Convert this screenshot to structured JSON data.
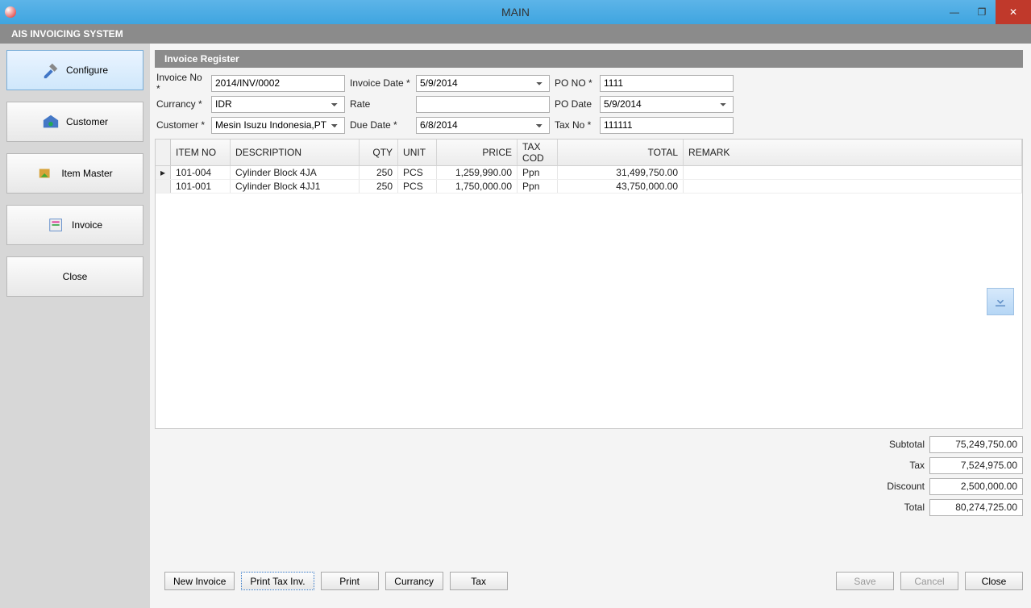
{
  "window": {
    "title": "MAIN"
  },
  "app_title": "AIS INVOICING SYSTEM",
  "sidebar": {
    "items": [
      {
        "label": "Configure",
        "icon": "configure",
        "active": true
      },
      {
        "label": "Customer",
        "icon": "customer",
        "active": false
      },
      {
        "label": "Item Master",
        "icon": "item-master",
        "active": false
      },
      {
        "label": "Invoice",
        "icon": "invoice",
        "active": false
      },
      {
        "label": "Close",
        "icon": "",
        "active": false
      }
    ]
  },
  "panel": {
    "title": "Invoice Register"
  },
  "form": {
    "labels": {
      "invoice_no": "Invoice No *",
      "invoice_date": "Invoice Date *",
      "po_no": "PO NO *",
      "currency": "Currancy *",
      "rate": "Rate",
      "po_date": "PO Date",
      "customer": "Customer *",
      "due_date": "Due Date *",
      "tax_no": "Tax No *"
    },
    "values": {
      "invoice_no": "2014/INV/0002",
      "invoice_date": "5/9/2014",
      "po_no": "1111",
      "currency": "IDR",
      "rate": "",
      "po_date": "5/9/2014",
      "customer": "Mesin Isuzu Indonesia,PT",
      "due_date": "6/8/2014",
      "tax_no": "111111"
    }
  },
  "grid": {
    "headers": {
      "item_no": "ITEM NO",
      "description": "DESCRIPTION",
      "qty": "QTY",
      "unit": "UNIT",
      "price": "PRICE",
      "tax_code": "TAX COD",
      "total": "TOTAL",
      "remark": "REMARK"
    },
    "rows": [
      {
        "item_no": "101-004",
        "description": "Cylinder Block 4JA",
        "qty": "250",
        "unit": "PCS",
        "price": "1,259,990.00",
        "tax_code": "Ppn",
        "total": "31,499,750.00",
        "remark": "",
        "current": true
      },
      {
        "item_no": "101-001",
        "description": "Cylinder Block 4JJ1",
        "qty": "250",
        "unit": "PCS",
        "price": "1,750,000.00",
        "tax_code": "Ppn",
        "total": "43,750,000.00",
        "remark": "",
        "current": false
      }
    ]
  },
  "totals": {
    "labels": {
      "subtotal": "Subtotal",
      "tax": "Tax",
      "discount": "Discount",
      "total": "Total"
    },
    "values": {
      "subtotal": "75,249,750.00",
      "tax": "7,524,975.00",
      "discount": "2,500,000.00",
      "total": "80,274,725.00"
    }
  },
  "footer": {
    "new_invoice": "New Invoice",
    "print_tax": "Print Tax Inv.",
    "print": "Print",
    "currency": "Currancy",
    "tax": "Tax",
    "save": "Save",
    "cancel": "Cancel",
    "close": "Close"
  }
}
